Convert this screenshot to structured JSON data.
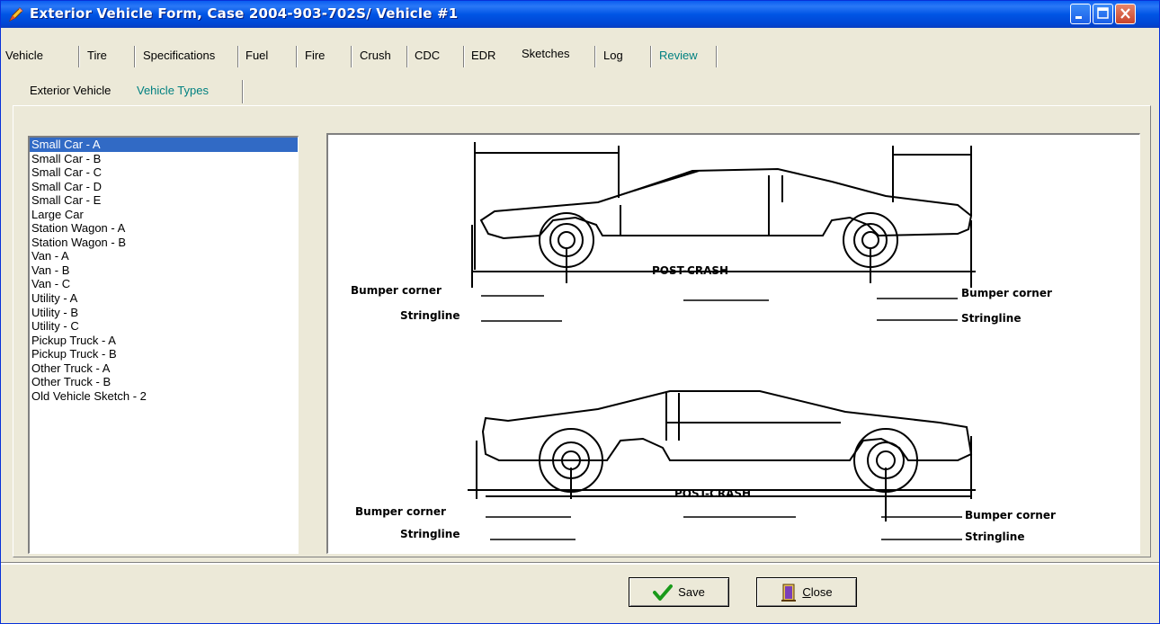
{
  "window": {
    "title": "Exterior Vehicle Form, Case 2004-903-702S/ Vehicle #1",
    "app_icon": "pencil-flame-icon"
  },
  "tabs": [
    {
      "label": "Vehicle"
    },
    {
      "label": "Tire"
    },
    {
      "label": "Specifications"
    },
    {
      "label": "Fuel"
    },
    {
      "label": "Fire"
    },
    {
      "label": "Crush"
    },
    {
      "label": "CDC"
    },
    {
      "label": "EDR"
    },
    {
      "label": "Sketches",
      "active": true
    },
    {
      "label": "Log"
    },
    {
      "label": "Review"
    }
  ],
  "subtabs": [
    {
      "label": "Exterior Vehicle"
    },
    {
      "label": "Vehicle Types",
      "active": true
    }
  ],
  "vehicle_list": {
    "selected": "Small Car - A",
    "items": [
      "Small Car - A",
      "Small Car - B",
      "Small Car - C",
      "Small Car - D",
      "Small Car - E",
      "Large Car",
      "Station Wagon - A",
      "Station Wagon - B",
      "Van - A",
      "Van - B",
      "Van - C",
      "Utility - A",
      "Utility - B",
      "Utility - C",
      "Pickup Truck - A",
      "Pickup Truck - B",
      "Other Truck - A",
      "Other Truck - B",
      "Old Vehicle Sketch - 2"
    ]
  },
  "sketch": {
    "top": {
      "center_label": "POST-CRASH",
      "left_bumper": "Bumper corner",
      "left_stringline": "Stringline",
      "right_bumper": "Bumper corner",
      "right_stringline": "Stringline"
    },
    "bottom": {
      "center_label": "POST-CRASH",
      "left_bumper": "Bumper corner",
      "left_stringline": "Stringline",
      "right_bumper": "Bumper corner",
      "right_stringline": "Stringline"
    }
  },
  "buttons": {
    "save": {
      "label": "Save",
      "icon": "checkmark-icon"
    },
    "close": {
      "label": "Close",
      "hotkey": "C",
      "label_rest": "lose",
      "icon": "door-icon"
    }
  },
  "colors": {
    "title_bar": "#0055e5",
    "selection": "#316ac5",
    "review_tab": "#008080"
  }
}
